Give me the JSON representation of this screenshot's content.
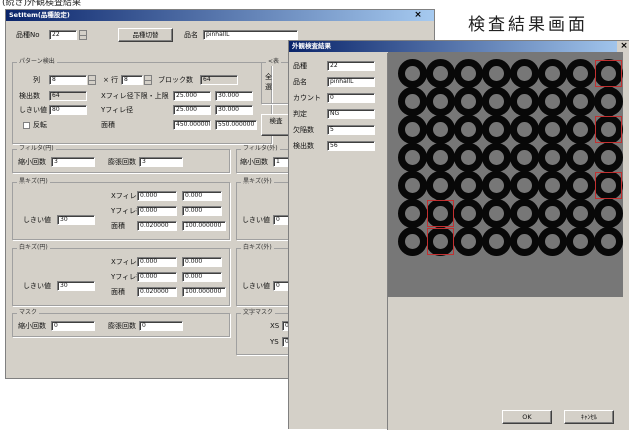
{
  "captions": {
    "top": "(続き)外観検査結果",
    "right": "検査結果画面"
  },
  "settings_window": {
    "title": "SetItem(品種設定)",
    "close": "×",
    "hinban_label": "品種No",
    "hinban_value": "22",
    "switch_button": "品種切替",
    "hinmei_label": "品名",
    "hinmei_value": "pinhallL",
    "pattern_group": {
      "title": "パターン検出",
      "col_label": "列",
      "col_value": "8",
      "row_label": "× 行",
      "row_value": "8",
      "block_label": "ブロック数",
      "block_value": "64",
      "detect_label": "検出数",
      "detect_value": "64",
      "thresh_label": "しきい値",
      "thresh_value": "80",
      "invert_label": "反転",
      "x_label": "Xフィレ径下限・上限",
      "x_min": "25.000",
      "x_max": "30.000",
      "y_label": "Yフィレ径",
      "y_min": "25.000",
      "y_max": "30.000",
      "area_label": "面積",
      "area_min": "450.000000",
      "area_max": "550.000000"
    },
    "side_right": {
      "top_partial": "<表",
      "top_partial2": "全",
      "top_partial3": "選",
      "check_partial": "検査"
    },
    "filter_left": {
      "title": "フィルタ(円)",
      "shrink_label": "縮小回数",
      "shrink_value": "3",
      "expand_label": "膨張回数",
      "expand_value": "3"
    },
    "filter_right": {
      "title": "フィルタ(外)",
      "shrink_label": "縮小回数",
      "shrink_value": "1"
    },
    "black_circle": {
      "title": "黒キズ(円)",
      "thresh_label": "しきい値",
      "thresh_value": "30",
      "x_label": "Xフィレ径",
      "x_min": "0.000",
      "x_max": "0.000",
      "y_label": "Yフィレ径",
      "y_min": "0.000",
      "y_max": "0.000",
      "area_label": "面積",
      "area_min": "0.020000",
      "area_max": "100.000000"
    },
    "black_outer": {
      "title": "黒キズ(外)",
      "thresh_label": "しきい値",
      "thresh_value": "0"
    },
    "white_circle": {
      "title": "白キズ(円)",
      "thresh_label": "しきい値",
      "thresh_value": "30",
      "x_label": "Xフィレ径",
      "x_min": "0.000",
      "x_max": "0.000",
      "y_label": "Yフィレ径",
      "y_min": "0.000",
      "y_max": "0.000",
      "area_label": "面積",
      "area_min": "0.020000",
      "area_max": "100.000000"
    },
    "white_outer": {
      "title": "白キズ(外)",
      "thresh_label": "しきい値",
      "thresh_value": "0"
    },
    "mask": {
      "title": "マスク",
      "shrink_label": "縮小回数",
      "shrink_value": "0",
      "expand_label": "膨張回数",
      "expand_value": "0"
    },
    "text_mask": {
      "title": "文字マスク",
      "xs_label": "XS",
      "xs_value": "0",
      "ys_label": "YS",
      "ys_value": "0"
    }
  },
  "result_window": {
    "title": "外観検査結果",
    "close": "×",
    "fields": [
      {
        "label": "品種",
        "value": "22"
      },
      {
        "label": "品名",
        "value": "pinhallL"
      },
      {
        "label": "カウント",
        "value": "0"
      },
      {
        "label": "判定",
        "value": "NG"
      },
      {
        "label": "欠陥数",
        "value": "5"
      },
      {
        "label": "検出数",
        "value": "56"
      }
    ],
    "ok_button": "OK",
    "cancel_button": "ｷｬﾝｾﾙ"
  }
}
